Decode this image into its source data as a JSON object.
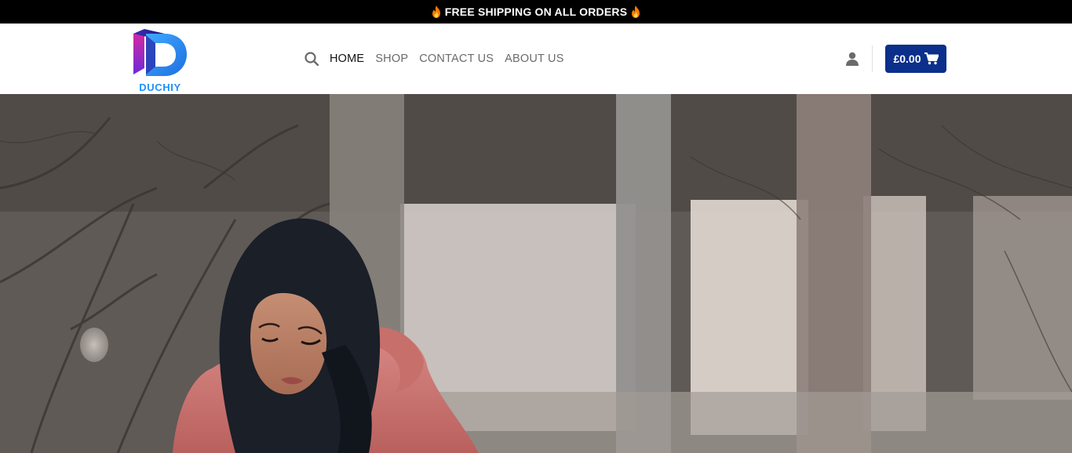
{
  "announcement": {
    "text": "FREE SHIPPING ON ALL ORDERS"
  },
  "brand": {
    "name": "DUCHIY"
  },
  "nav": {
    "items": [
      {
        "label": "HOME",
        "active": true
      },
      {
        "label": "SHOP",
        "active": false
      },
      {
        "label": "CONTACT US",
        "active": false
      },
      {
        "label": "ABOUT US",
        "active": false
      }
    ]
  },
  "header_actions": {
    "account_icon": "user-icon",
    "cart_total": "£0.00",
    "cart_icon": "cart-icon",
    "search_icon": "search-icon"
  },
  "hero": {
    "image_icon": "hero-photo"
  },
  "colors": {
    "topbar_bg": "#000000",
    "cart_button_bg": "#0b2f8a",
    "logo_accent": "#1e90ff"
  }
}
